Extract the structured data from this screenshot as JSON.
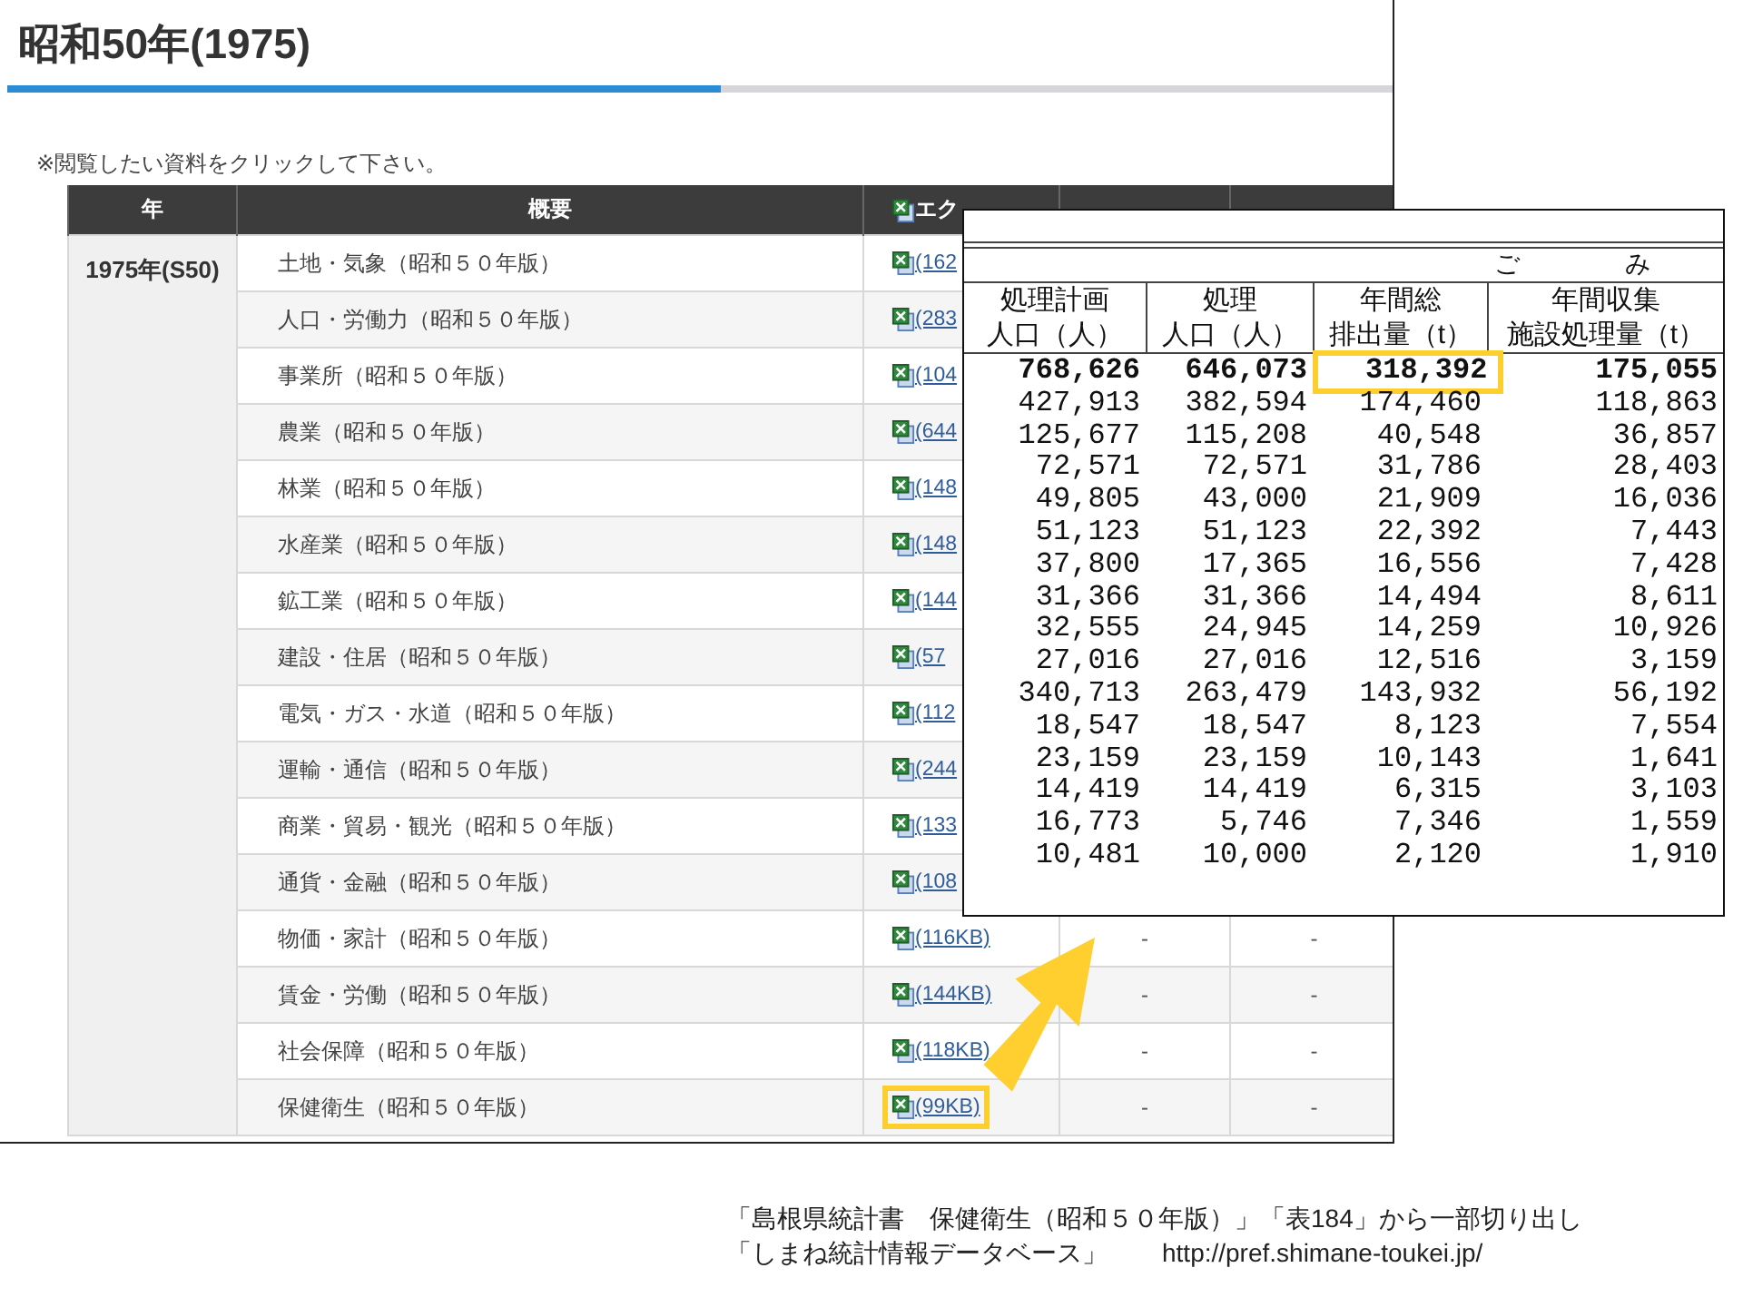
{
  "page": {
    "title": "昭和50年(1975)",
    "note": "※閲覧したい資料をクリックして下さい。",
    "table": {
      "columns": [
        {
          "kind": "text",
          "label": "年"
        },
        {
          "kind": "text",
          "label": "概要"
        },
        {
          "kind": "file",
          "label": "エク"
        },
        {
          "kind": "blank"
        },
        {
          "kind": "blank"
        }
      ],
      "year": "1975年(S50)",
      "rows": [
        {
          "summary": "土地・気象（昭和５０年版）",
          "file": "(162",
          "highlighted": false
        },
        {
          "summary": "人口・労働力（昭和５０年版）",
          "file": "(283",
          "highlighted": false
        },
        {
          "summary": "事業所（昭和５０年版）",
          "file": "(104",
          "highlighted": false
        },
        {
          "summary": "農業（昭和５０年版）",
          "file": "(644",
          "highlighted": false
        },
        {
          "summary": "林業（昭和５０年版）",
          "file": "(148",
          "highlighted": false
        },
        {
          "summary": "水産業（昭和５０年版）",
          "file": "(148",
          "highlighted": false
        },
        {
          "summary": "鉱工業（昭和５０年版）",
          "file": "(144",
          "highlighted": false
        },
        {
          "summary": "建設・住居（昭和５０年版）",
          "file": "(57",
          "highlighted": false
        },
        {
          "summary": "電気・ガス・水道（昭和５０年版）",
          "file": "(112",
          "highlighted": false
        },
        {
          "summary": "運輸・通信（昭和５０年版）",
          "file": "(244",
          "highlighted": false
        },
        {
          "summary": "商業・貿易・観光（昭和５０年版）",
          "file": "(133",
          "highlighted": false
        },
        {
          "summary": "通貨・金融（昭和５０年版）",
          "file": "(108",
          "highlighted": false
        },
        {
          "summary": "物価・家計（昭和５０年版）",
          "file": "(116KB)",
          "column_4": "-",
          "column_5": "-",
          "highlighted": false
        },
        {
          "summary": "賃金・労働（昭和５０年版）",
          "file": "(144KB)",
          "column_4": "-",
          "column_5": "-",
          "highlighted": false
        },
        {
          "summary": "社会保障（昭和５０年版）",
          "file": "(118KB)",
          "column_4": "-",
          "column_5": "-",
          "highlighted": false
        },
        {
          "summary": "保健衛生（昭和５０年版）",
          "file": "(99KB)",
          "column_4": "-",
          "column_5": "-",
          "highlighted": true
        }
      ]
    }
  },
  "excerpt": {
    "group_label": "ご　　み",
    "columns": [
      {
        "line_1": "処理計画",
        "line_2": "人口（人）"
      },
      {
        "line_1": "処理",
        "line_2": "人口（人）"
      },
      {
        "line_1": "年間総",
        "line_2": "排出量（t）"
      },
      {
        "line_1": "年間収集",
        "line_2": "施設処理量（t）"
      }
    ],
    "rows": [
      {
        "bold": true,
        "cells": [
          "768,626",
          "646,073",
          "318,392",
          "175,055"
        ],
        "highlighted": [
          false,
          false,
          true,
          false
        ]
      },
      {
        "bold": false,
        "cells": [
          "427,913",
          "382,594",
          "174,460",
          "118,863"
        ],
        "highlighted": [
          false,
          false,
          false,
          false
        ]
      },
      {
        "bold": false,
        "cells": [
          "125,677",
          "115,208",
          "40,548",
          "36,857"
        ],
        "highlighted": [
          false,
          false,
          false,
          false
        ]
      },
      {
        "bold": false,
        "cells": [
          "72,571",
          "72,571",
          "31,786",
          "28,403"
        ],
        "highlighted": [
          false,
          false,
          false,
          false
        ]
      },
      {
        "bold": false,
        "cells": [
          "49,805",
          "43,000",
          "21,909",
          "16,036"
        ],
        "highlighted": [
          false,
          false,
          false,
          false
        ]
      },
      {
        "bold": false,
        "cells": [
          "51,123",
          "51,123",
          "22,392",
          "7,443"
        ],
        "highlighted": [
          false,
          false,
          false,
          false
        ]
      },
      {
        "bold": false,
        "cells": [
          "37,800",
          "17,365",
          "16,556",
          "7,428"
        ],
        "highlighted": [
          false,
          false,
          false,
          false
        ]
      },
      {
        "bold": false,
        "cells": [
          "31,366",
          "31,366",
          "14,494",
          "8,611"
        ],
        "highlighted": [
          false,
          false,
          false,
          false
        ]
      },
      {
        "bold": false,
        "cells": [
          "32,555",
          "24,945",
          "14,259",
          "10,926"
        ],
        "highlighted": [
          false,
          false,
          false,
          false
        ]
      },
      {
        "bold": false,
        "cells": [
          "27,016",
          "27,016",
          "12,516",
          "3,159"
        ],
        "highlighted": [
          false,
          false,
          false,
          false
        ]
      },
      {
        "bold": false,
        "cells": [
          "340,713",
          "263,479",
          "143,932",
          "56,192"
        ],
        "highlighted": [
          false,
          false,
          false,
          false
        ]
      },
      {
        "bold": false,
        "cells": [
          "18,547",
          "18,547",
          "8,123",
          "7,554"
        ],
        "highlighted": [
          false,
          false,
          false,
          false
        ]
      },
      {
        "bold": false,
        "cells": [
          "23,159",
          "23,159",
          "10,143",
          "1,641"
        ],
        "highlighted": [
          false,
          false,
          false,
          false
        ]
      },
      {
        "bold": false,
        "cells": [
          "14,419",
          "14,419",
          "6,315",
          "3,103"
        ],
        "highlighted": [
          false,
          false,
          false,
          false
        ]
      },
      {
        "bold": false,
        "cells": [
          "16,773",
          "5,746",
          "7,346",
          "1,559"
        ],
        "highlighted": [
          false,
          false,
          false,
          false
        ]
      },
      {
        "bold": false,
        "cells": [
          "10,481",
          "10,000",
          "2,120",
          "1,910"
        ],
        "highlighted": [
          false,
          false,
          false,
          false
        ]
      }
    ]
  },
  "caption": {
    "line_1": "「島根県統計書　保健衛生（昭和５０年版）」「表184」から一部切り出し",
    "source": "「しまね統計情報データベース」",
    "url": "http://pref.shimane-toukei.jp/"
  }
}
